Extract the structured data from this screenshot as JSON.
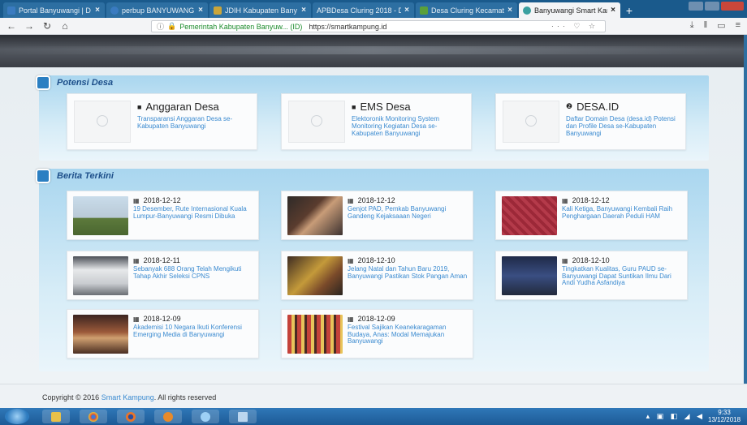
{
  "browser": {
    "tabs": [
      {
        "title": "Portal Banyuwangi | D",
        "color": "#3a7bc0",
        "active": false
      },
      {
        "title": "perbup BANYUWANG",
        "color": "#3a7bc0",
        "active": false
      },
      {
        "title": "JDIH Kabupaten Bany",
        "color": "#caa53a",
        "active": false
      },
      {
        "title": "APBDesa Cluring 2018 - D",
        "color": "#555555",
        "active": false
      },
      {
        "title": "Desa Cluring Kecamat",
        "color": "#5aa03a",
        "active": false
      },
      {
        "title": "Banyuwangi Smart Kam",
        "color": "#3aa0a0",
        "active": true
      }
    ],
    "new_tab_label": "+",
    "site_identity": "Pemerintah Kabupaten Banyuw... (ID)",
    "url": "https://smartkampung.id",
    "url_tools": "··· ♡ ☆"
  },
  "sections": {
    "potensi": {
      "title": "Potensi Desa",
      "items": [
        {
          "title": "Anggaran Desa",
          "desc": "Transparansi Anggaran Desa se-Kabupaten Banyuwangi",
          "icon": "■"
        },
        {
          "title": "EMS Desa",
          "desc": "Elektoronik Monitoring System Monitoring Kegiatan Desa se-Kabupaten Banyuwangi",
          "icon": "■"
        },
        {
          "title": "DESA.ID",
          "desc": "Daftar Domain Desa (desa.id) Potensi dan Profile Desa se-Kabupaten Banyuwangi",
          "icon": "❷"
        }
      ]
    },
    "berita": {
      "title": "Berita Terkini",
      "items": [
        {
          "date": "2018-12-12",
          "desc": "19 Desember, Rute Internasional Kuala Lumpur-Banyuwangi Resmi Dibuka"
        },
        {
          "date": "2018-12-12",
          "desc": "Genjot PAD, Pemkab Banyuwangi Gandeng Kejaksaaan Negeri"
        },
        {
          "date": "2018-12-12",
          "desc": "Kali Ketiga, Banyuwangi Kembali Raih Penghargaan Daerah Peduli HAM"
        },
        {
          "date": "2018-12-11",
          "desc": "Sebanyak 688 Orang Telah Mengikuti Tahap Akhir Seleksi CPNS"
        },
        {
          "date": "2018-12-10",
          "desc": "Jelang Natal dan Tahun Baru 2019, Banyuwangi Pastikan Stok Pangan Aman"
        },
        {
          "date": "2018-12-10",
          "desc": "Tingkatkan Kualitas, Guru PAUD se- Banyuwangi Dapat Suntikan Ilmu Dari Andi Yudha Asfandiya"
        },
        {
          "date": "2018-12-09",
          "desc": "Akademisi 10 Negara Ikuti Konferensi Emerging Media di Banyuwangi"
        },
        {
          "date": "2018-12-09",
          "desc": "Festival Sajikan Keanekaragaman Budaya, Anas: Modal Memajukan Banyuwangi"
        }
      ]
    }
  },
  "footer": {
    "prefix": "Copyright © 2016",
    "brand": "Smart Kampung",
    "suffix": ". All rights reserved"
  },
  "taskbar": {
    "time": "9:33",
    "date": "13/12/2018"
  }
}
